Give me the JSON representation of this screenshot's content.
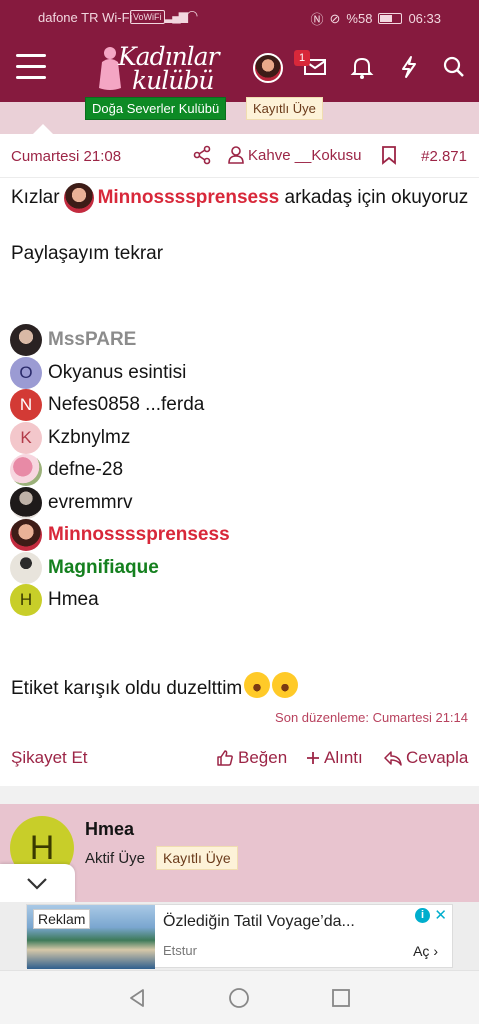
{
  "statusbar": {
    "carrier": "dafone TR Wi-Fi",
    "volte": "VoWiFi",
    "battery": "%58",
    "time": "06:33"
  },
  "header": {
    "logo_line1": "Kadınlar",
    "logo_line2": "kulübü",
    "message_badge": "1"
  },
  "author_tags": {
    "group": "Doğa Severler Kulübü",
    "status": "Kayıtlı Üye"
  },
  "post": {
    "date": "Cumartesi 21:08",
    "reactor": "Kahve __Kokusu",
    "number": "#2.871",
    "intro_before": "Kızlar",
    "intro_mention": "Minnossssprensess",
    "intro_after": "arkadaş için okuyoruz",
    "share_again": "Paylaşayım tekrar",
    "tagged_users": [
      {
        "name": "MssPARE",
        "initial": ""
      },
      {
        "name": "Okyanus esintisi",
        "initial": "O"
      },
      {
        "name": "Nefes0858 ...ferda",
        "initial": "N"
      },
      {
        "name": "Kzbnylmz",
        "initial": "K"
      },
      {
        "name": "defne-28",
        "initial": ""
      },
      {
        "name": "evremmrv",
        "initial": ""
      },
      {
        "name": "Minnossssprensess",
        "initial": ""
      },
      {
        "name": "Magnifiaque",
        "initial": ""
      },
      {
        "name": "Hmea",
        "initial": "H"
      }
    ],
    "closing_text": "Etiket karışık oldu duzelttim",
    "edited": "Son düzenleme: Cumartesi 21:14",
    "actions": {
      "report": "Şikayet Et",
      "like": "Beğen",
      "quote": "Alıntı",
      "reply": "Cevapla"
    }
  },
  "next_post": {
    "initial": "H",
    "username": "Hmea",
    "role": "Aktif Üye",
    "status": "Kayıtlı Üye"
  },
  "ad": {
    "label": "Reklam",
    "title": "Özlediğin Tatil Voyage’da...",
    "source": "Etstur",
    "cta": "Aç"
  },
  "colors": {
    "brand": "#861a3e",
    "mention": "#d8283a",
    "green_name": "#15801f",
    "pink_bg": "#e8c4cf"
  }
}
